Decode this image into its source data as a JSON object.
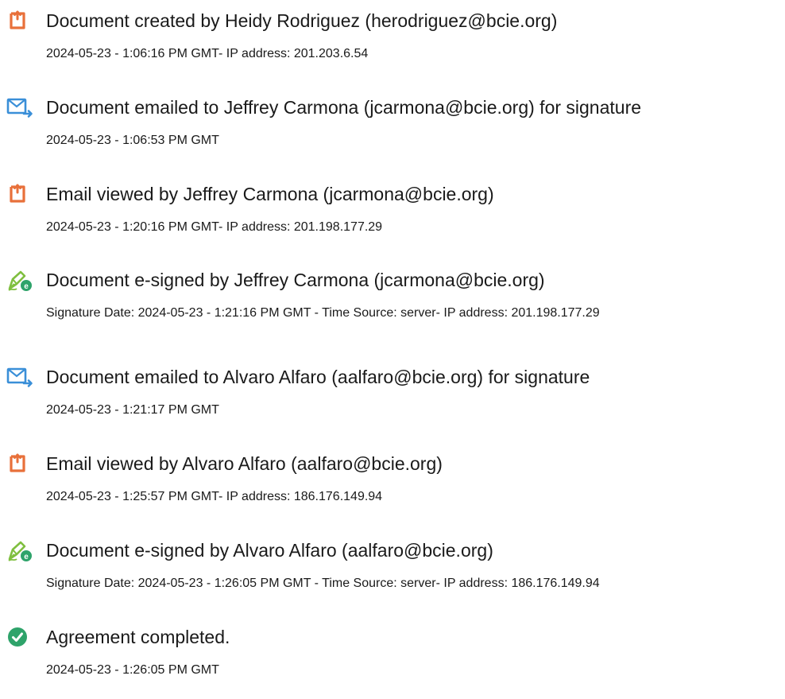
{
  "events": [
    {
      "icon": "document-icon",
      "title": "Document created by Heidy Rodriguez (herodriguez@bcie.org)",
      "detail": "2024-05-23 - 1:06:16 PM GMT- IP address: 201.203.6.54"
    },
    {
      "icon": "email-sent-icon",
      "title": "Document emailed to Jeffrey Carmona (jcarmona@bcie.org) for signature",
      "detail": "2024-05-23 - 1:06:53 PM GMT"
    },
    {
      "icon": "document-icon",
      "title": "Email viewed by Jeffrey Carmona (jcarmona@bcie.org)",
      "detail": "2024-05-23 - 1:20:16 PM GMT- IP address: 201.198.177.29"
    },
    {
      "icon": "e-sign-pen-icon",
      "title": "Document e-signed by Jeffrey Carmona (jcarmona@bcie.org)",
      "detail": "Signature Date: 2024-05-23 - 1:21:16 PM GMT - Time Source: server- IP address: 201.198.177.29"
    },
    {
      "icon": "email-sent-icon",
      "title": "Document emailed to Alvaro Alfaro (aalfaro@bcie.org) for signature",
      "detail": "2024-05-23 - 1:21:17 PM GMT"
    },
    {
      "icon": "document-icon",
      "title": "Email viewed by Alvaro Alfaro (aalfaro@bcie.org)",
      "detail": "2024-05-23 - 1:25:57 PM GMT- IP address: 186.176.149.94"
    },
    {
      "icon": "e-sign-pen-icon",
      "title": "Document e-signed by Alvaro Alfaro (aalfaro@bcie.org)",
      "detail": "Signature Date: 2024-05-23 - 1:26:05 PM GMT - Time Source: server- IP address: 186.176.149.94"
    },
    {
      "icon": "checkmark-circle-icon",
      "title": "Agreement completed.",
      "detail": "2024-05-23 - 1:26:05 PM GMT"
    }
  ],
  "colors": {
    "document_icon": "#e8703a",
    "email_icon": "#3a8fd8",
    "sign_pen_icon": "#7fbf3f",
    "sign_badge": "#2ea36a",
    "complete_icon": "#2ea36a"
  }
}
